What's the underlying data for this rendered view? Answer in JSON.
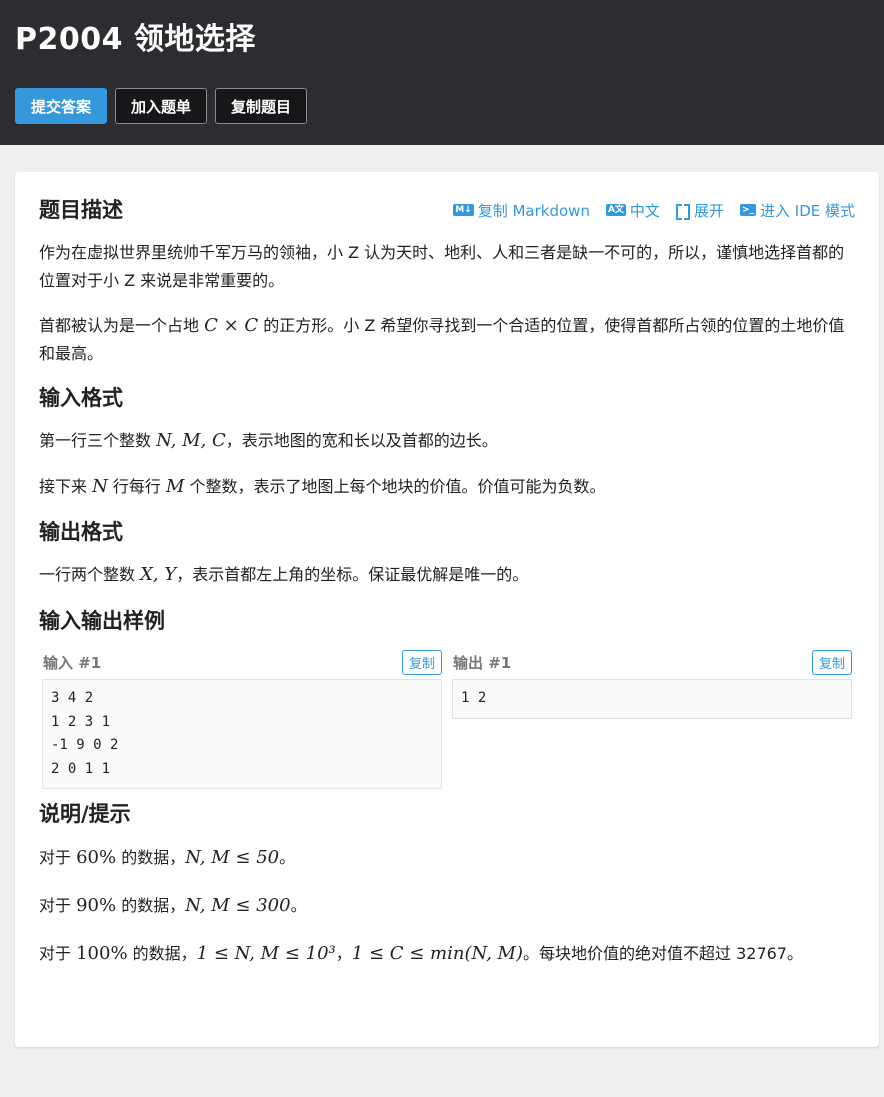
{
  "header": {
    "title": "P2004 领地选择",
    "buttons": {
      "submit": "提交答案",
      "add_list": "加入题单",
      "copy": "复制题目"
    }
  },
  "toolbar": {
    "copy_markdown": "复制 Markdown",
    "language": "中文",
    "expand": "展开",
    "ide": "进入 IDE 模式"
  },
  "sections": {
    "description": {
      "title": "题目描述",
      "p1": "作为在虚拟世界里统帅千军万马的领袖，小 Z 认为天时、地利、人和三者是缺一不可的，所以，谨慎地选择首都的位置对于小 Z 来说是非常重要的。",
      "p2_a": "首都被认为是一个占地 ",
      "p2_math": "C × C",
      "p2_b": " 的正方形。小 Z 希望你寻找到一个合适的位置，使得首都所占领的位置的土地价值和最高。"
    },
    "input": {
      "title": "输入格式",
      "p1_a": "第一行三个整数 ",
      "p1_math": "N, M, C",
      "p1_b": "，表示地图的宽和长以及首都的边长。",
      "p2_a": "接下来 ",
      "p2_m1": "N",
      "p2_b": " 行每行 ",
      "p2_m2": "M",
      "p2_c": " 个整数，表示了地图上每个地块的价值。价值可能为负数。"
    },
    "output": {
      "title": "输出格式",
      "p1_a": "一行两个整数 ",
      "p1_math": "X, Y",
      "p1_b": "，表示首都左上角的坐标。保证最优解是唯一的。"
    },
    "samples": {
      "title": "输入输出样例",
      "input_label": "输入 #1",
      "output_label": "输出 #1",
      "copy_label": "复制",
      "input_text": "3 4 2\n1 2 3 1\n-1 9 0 2\n2 0 1 1",
      "output_text": "1 2"
    },
    "hint": {
      "title": "说明/提示",
      "l1_a": "对于 ",
      "l1_pct": "60%",
      "l1_b": " 的数据，",
      "l1_math": "N, M ≤ 50",
      "l1_c": "。",
      "l2_a": "对于 ",
      "l2_pct": "90%",
      "l2_b": " 的数据，",
      "l2_math": "N, M ≤ 300",
      "l2_c": "。",
      "l3_a": "对于 ",
      "l3_pct": "100%",
      "l3_b": " 的数据，",
      "l3_m1": "1 ≤ N, M ≤ 10³",
      "l3_sep": "，",
      "l3_m2": "1 ≤ C ≤ min(N, M)",
      "l3_c": "。每块地价值的绝对值不超过 32767。"
    }
  }
}
